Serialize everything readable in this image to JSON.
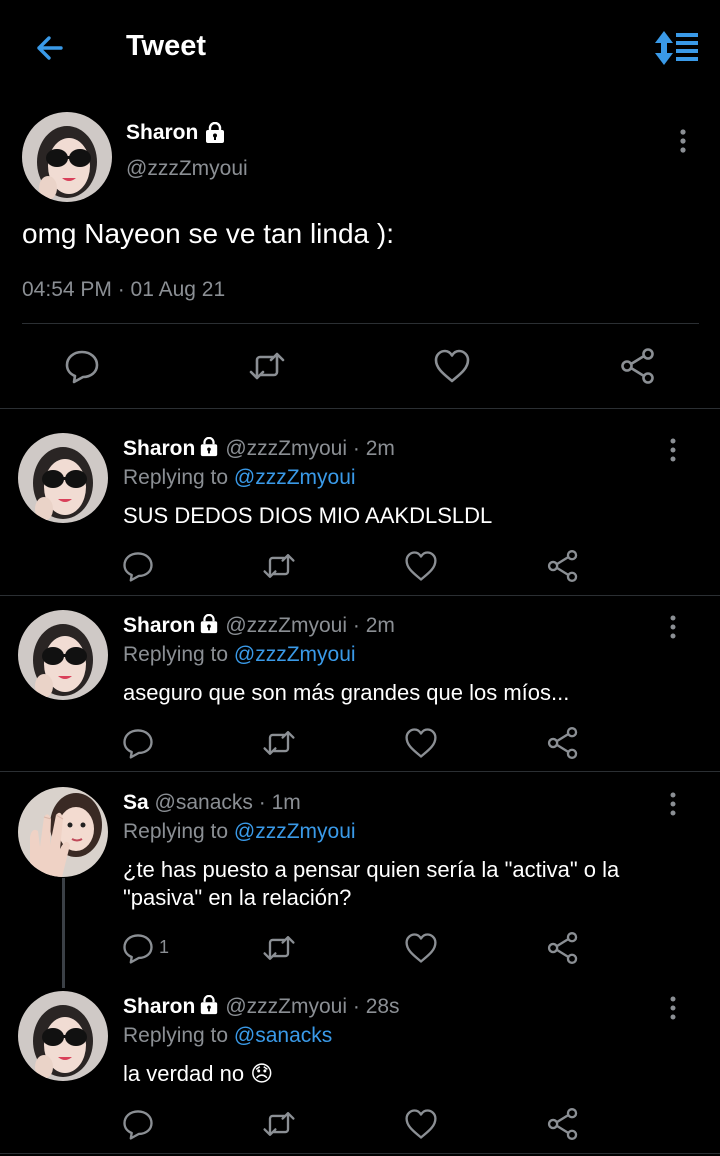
{
  "colors": {
    "background": "#000000",
    "accent": "#3a9ae8",
    "muted_text": "#8b8f94",
    "divider": "#2b2f33",
    "icon": "#8b8f94"
  },
  "header": {
    "title": "Tweet",
    "back_icon": "arrow-left-icon",
    "sort_icon": "sort-sparkle-icon"
  },
  "main_tweet": {
    "name": "Sharon",
    "locked": true,
    "handle": "@zzzZmyoui",
    "text": "omg Nayeon se ve tan linda ):",
    "timestamp": "04:54 PM · 01 Aug 21",
    "actions": [
      "reply-icon",
      "retweet-icon",
      "like-icon",
      "share-icon"
    ]
  },
  "replies": [
    {
      "name": "Sharon",
      "locked": true,
      "handle": "@zzzZmyoui",
      "dot": "·",
      "time": "2m",
      "replying_prefix": "Replying to",
      "replying_to": "@zzzZmyoui",
      "text": "SUS DEDOS DIOS MIO AAKDLSLDL",
      "reply_count": ""
    },
    {
      "name": "Sharon",
      "locked": true,
      "handle": "@zzzZmyoui",
      "dot": "·",
      "time": "2m",
      "replying_prefix": "Replying to",
      "replying_to": "@zzzZmyoui",
      "text": "aseguro que son más grandes que los míos...",
      "reply_count": ""
    },
    {
      "name": "Sa",
      "locked": false,
      "handle": "@sanacks",
      "dot": "·",
      "time": "1m",
      "replying_prefix": "Replying to",
      "replying_to": "@zzzZmyoui",
      "text": "¿te has puesto a pensar quien sería la \"activa\" o la \"pasiva\" en la relación?",
      "reply_count": "1"
    },
    {
      "name": "Sharon",
      "locked": true,
      "handle": "@zzzZmyoui",
      "dot": "·",
      "time": "28s",
      "replying_prefix": "Replying to",
      "replying_to": "@sanacks",
      "text": "la verdad no",
      "emoji": "😞",
      "reply_count": ""
    }
  ]
}
